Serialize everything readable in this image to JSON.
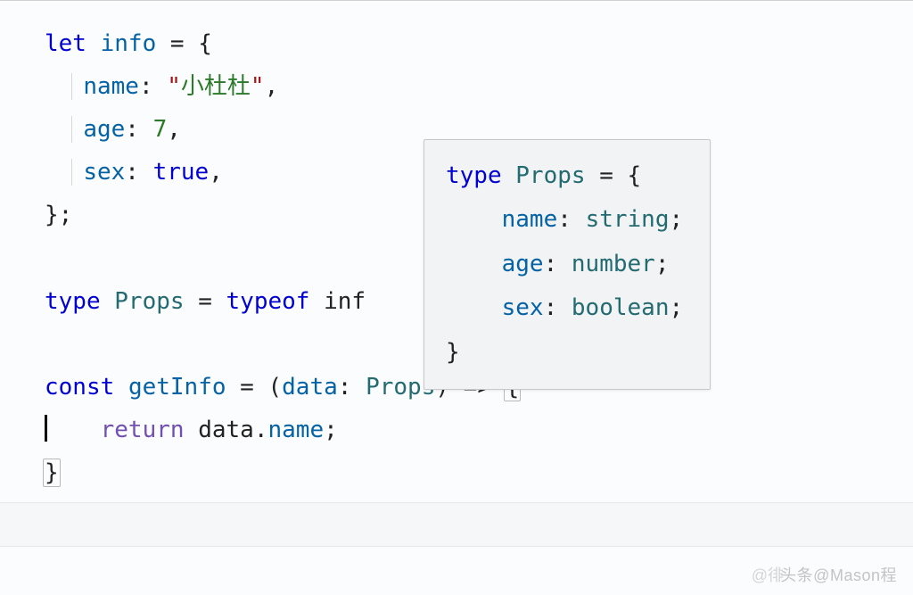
{
  "code": {
    "line1": {
      "let": "let",
      "info": "info",
      "eq": " = ",
      "brace": "{"
    },
    "line2": {
      "name_key": "name",
      "colon": ": ",
      "q1": "\"",
      "str": "小杜杜",
      "q2": "\"",
      "comma": ","
    },
    "line3": {
      "age_key": "age",
      "colon": ": ",
      "num": "7",
      "comma": ","
    },
    "line4": {
      "sex_key": "sex",
      "colon": ": ",
      "bool": "true",
      "comma": ","
    },
    "line5": {
      "brace": "}",
      "semi": ";"
    },
    "line7": {
      "type": "type",
      "props": "Props",
      "eq": " = ",
      "typeof": "typeof",
      "inf": " inf"
    },
    "line9": {
      "const": "const",
      "getInfo": "getInfo",
      "eq": " = (",
      "data": "data",
      "colon": ": ",
      "props": "Props",
      "arrow": ") => ",
      "brace": "{"
    },
    "line10": {
      "return": "return",
      "data": " data",
      "dot": ".",
      "name": "name",
      "semi": ";"
    },
    "line11": {
      "brace": "}"
    }
  },
  "tooltip": {
    "line1": {
      "type": "type",
      "props": " Props",
      "rest": " = {"
    },
    "line2": {
      "prop": "name",
      "colon": ": ",
      "ptype": "string",
      "semi": ";"
    },
    "line3": {
      "prop": "age",
      "colon": ": ",
      "ptype": "number",
      "semi": ";"
    },
    "line4": {
      "prop": "sex",
      "colon": ": ",
      "ptype": "boolean",
      "semi": ";"
    },
    "line5": {
      "brace": "}"
    }
  },
  "watermark": {
    "left": "@徘",
    "right": "头条@Mason程"
  }
}
